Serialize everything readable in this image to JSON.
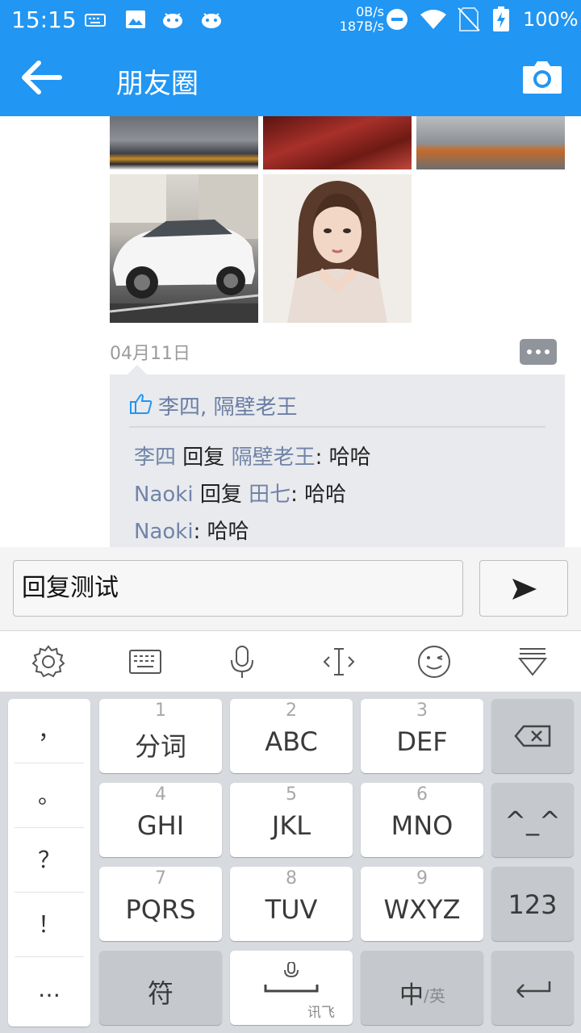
{
  "status_bar": {
    "time": "15:15",
    "net_down": "0B/s",
    "net_up": "187B/s",
    "battery": "100%",
    "color": "#2196f3"
  },
  "app_bar": {
    "title": "朋友圈",
    "back_icon": "arrow-left-icon",
    "camera_icon": "camera-icon"
  },
  "post": {
    "date": "04月11日",
    "likes": "李四, 隔壁老王",
    "comments": [
      {
        "from": "李四",
        "verb": "回复",
        "to": "隔壁老王",
        "text": ": 哈哈"
      },
      {
        "from": "Naoki",
        "verb": "回复",
        "to": "田七",
        "text": ": 哈哈"
      },
      {
        "from": "Naoki",
        "verb": "",
        "to": "",
        "text": ": 哈哈"
      }
    ]
  },
  "reply": {
    "value": "回复测试",
    "send_icon": "send-icon"
  },
  "ime_toolbar": [
    "gear-icon",
    "keyboard-icon",
    "microphone-icon",
    "cursor-icon",
    "emoji-icon",
    "collapse-icon"
  ],
  "keyboard": {
    "punctuation": [
      "，",
      "。",
      "？",
      "！",
      "…"
    ],
    "keys": {
      "k1": {
        "num": "1",
        "label": "分词"
      },
      "k2": {
        "num": "2",
        "label": "ABC"
      },
      "k3": {
        "num": "3",
        "label": "DEF"
      },
      "k4": {
        "num": "4",
        "label": "GHI"
      },
      "k5": {
        "num": "5",
        "label": "JKL"
      },
      "k6": {
        "num": "6",
        "label": "MNO"
      },
      "k7": {
        "num": "7",
        "label": "PQRS"
      },
      "k8": {
        "num": "8",
        "label": "TUV"
      },
      "k9": {
        "num": "9",
        "label": "WXYZ"
      },
      "emoticon": "^_^",
      "num123": "123",
      "symbols": "符",
      "space_brand": "讯飞",
      "lang_main": "中",
      "lang_alt": "/英"
    }
  }
}
